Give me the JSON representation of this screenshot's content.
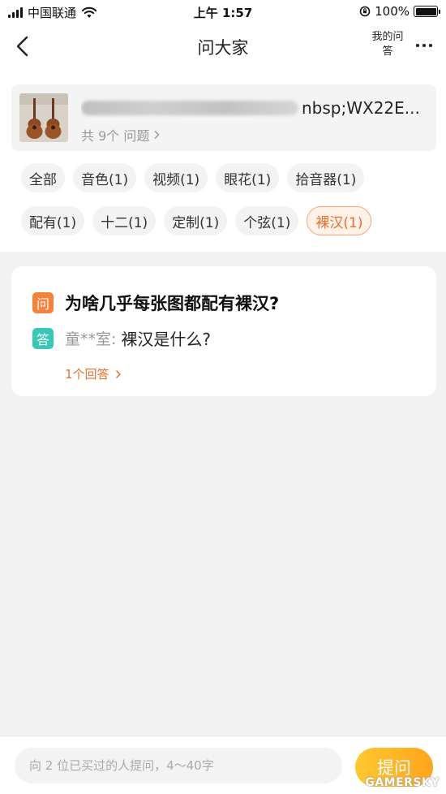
{
  "status_bar": {
    "carrier": "中国联通",
    "time": "上午 1:57",
    "battery_percent": "100%",
    "battery_level": 1.0
  },
  "nav": {
    "title": "问大家",
    "my_questions": "我的问答",
    "back_icon": "chevron-left-icon",
    "more_icon": "more-dots-icon"
  },
  "product": {
    "name_visible_suffix": "nbsp;WX22E...",
    "question_count": "共 9个 问题"
  },
  "tags": {
    "row1": [
      "全部",
      "音色(1)",
      "视频(1)",
      "眼花(1)",
      "拾音器(1)"
    ],
    "row2": [
      "配有(1)",
      "十二(1)",
      "定制(1)",
      "个弦(1)",
      "裸汉(1)"
    ],
    "active": "裸汉(1)"
  },
  "qa": {
    "question_badge": "问",
    "question": "为啥几乎每张图都配有裸汉?",
    "answer_badge": "答",
    "answer_user": "童**室:",
    "answer": "裸汉是什么?",
    "answers_link": "1个回答"
  },
  "bottom": {
    "input_placeholder": "向 2 位已买过的人提问，4～40字",
    "ask_button": "提问",
    "watermark": "GAMERSKY"
  },
  "colors": {
    "accent_orange": "#e96f2c",
    "question_badge": "#f5813a",
    "answer_badge": "#39c7b6",
    "ask_button": "#ffb320"
  }
}
